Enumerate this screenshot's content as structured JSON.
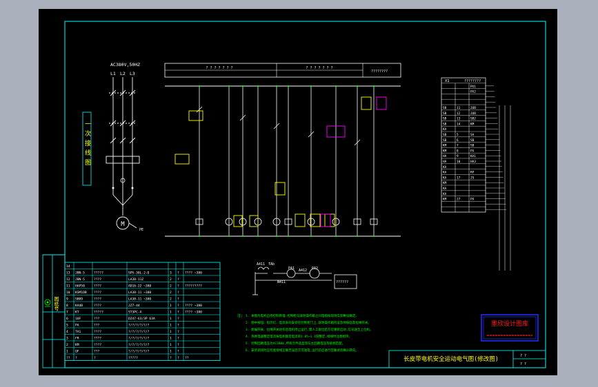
{
  "drawing": {
    "title": "长皮带电机安全运动电气图(修改图)",
    "stamp_text": "墨欣设计图库",
    "supply_label": "AC380V,50HZ",
    "phase_labels": [
      "L1",
      "L2",
      "L3"
    ],
    "motor_label": "M",
    "ground_label": "PE",
    "primary_circuit_label": "一次接线图",
    "left_stamp": "图纸号",
    "colors": {
      "background": "#000000",
      "frame": "#00ffff",
      "line": "#ffffff",
      "yellow": "#ffff00",
      "green": "#00ff00",
      "magenta": "#ff00ff",
      "red": "#ff2020",
      "blue": "#2030ff"
    }
  },
  "header_strip": {
    "left_title": "? ? ? ? ? ? ?",
    "mid_title": "? ? ? ? ? ? ?",
    "right_title": "????????"
  },
  "terminal_block": {
    "title": "X1",
    "title_right": "????????",
    "rows": [
      [
        "",
        "",
        "PX1"
      ],
      [
        "",
        "",
        "PX2"
      ],
      [
        "",
        "",
        ""
      ],
      [
        "",
        "",
        ""
      ],
      [
        "SB",
        "11",
        "JOB"
      ],
      [
        "SB",
        "12",
        "JOB"
      ],
      [
        "SB",
        "13",
        "SB2"
      ],
      [
        "SB",
        "14",
        "KM"
      ],
      [
        "KA",
        "",
        ""
      ],
      [
        "SB",
        "5",
        "SA"
      ],
      [
        "SB",
        "6",
        "SB"
      ],
      [
        "KM",
        "7",
        "SB"
      ],
      [
        "KM",
        "8",
        "PX"
      ],
      [
        "HA",
        "9",
        "KA1"
      ],
      [
        "HA",
        "10",
        "HA3"
      ],
      [
        "KA",
        "",
        ""
      ],
      [
        "KA",
        "",
        "RP"
      ],
      [
        "KA",
        "17",
        "JS"
      ],
      [
        "KM",
        "",
        ""
      ],
      [
        "KA",
        "",
        ""
      ],
      [
        "KA",
        "",
        ""
      ],
      [
        "KM",
        "27",
        "PX"
      ],
      [
        "",
        "",
        ""
      ],
      [
        "",
        "",
        ""
      ]
    ]
  },
  "parts_list": {
    "rows": [
      [
        "14",
        "",
        "",
        "",
        "",
        "",
        ""
      ],
      [
        "13",
        "JBN-5",
        "?????",
        "SPS-30L-2-D",
        "3",
        "?",
        "???? ~380"
      ],
      [
        "12",
        "JBN-5",
        "????",
        "LA38-11Z",
        "2",
        "?",
        ""
      ],
      [
        "11",
        "HAP50",
        "????",
        "AD16-22 ~380",
        "2",
        "?",
        "?????????"
      ],
      [
        "10",
        "KSM1DB",
        "????",
        "LA38-11 ~380",
        "2",
        "?",
        ""
      ],
      [
        "9",
        "SB09",
        "????",
        "LA38-11 ~380",
        "2",
        "?",
        ""
      ],
      [
        "8",
        "KA4B",
        "????",
        "JZ7-44",
        "1",
        "?",
        "???? ~380"
      ],
      [
        "7",
        "KT",
        "?????",
        "ST3PC-A",
        "1",
        "?",
        "???? ~380"
      ],
      [
        "6",
        "10F",
        "???",
        "DZ47-63/3P 63A",
        "1",
        "?",
        ""
      ],
      [
        "5",
        "PA",
        "???",
        "?/?/?/?/?/?",
        "1",
        "?",
        ""
      ],
      [
        "4",
        "TA1",
        "????",
        "?/?/?/?/?/?",
        "1",
        "?",
        ""
      ],
      [
        "3",
        "FR",
        "????",
        "?/?/?/?/?/?",
        "1",
        "?",
        ""
      ],
      [
        "2",
        "KM",
        "????",
        "?/?/?/?/?/?",
        "1",
        "?",
        ""
      ],
      [
        "1",
        "QF",
        "???",
        "?/?/?/?/?/?",
        "1",
        "?",
        ""
      ],
      [
        "??",
        "?",
        "?",
        "?????",
        "?",
        "?",
        "??"
      ]
    ]
  },
  "ammeter": {
    "ta_label": "TAb",
    "labels": [
      "A411",
      "PA1",
      "A412",
      "PA2",
      "N411"
    ],
    "box_label": "??????"
  },
  "notes": {
    "heading": "注:",
    "lines": [
      "1. 本图为电机启停控制原理,控制柜与就地操作箱之间电缆按现场实际敷设确定。",
      "2. 图中按钮、指示灯、电流表均安装在控制柜门上,就地操作箱内设急停按钮及拉绳开关。",
      "3. 跑偏开关、拉绳开关动作后电机停止运行,需人工复位后方可重新启动,信号送至上位机。",
      "4. 热继电器整定电流按电机额定电流的1.05~1.1倍整定,接线时注意相序。",
      "5. 控制回路电压为AC380V,所有元件选型须与主回路电压等级相匹配。",
      "6. 安装调试时应检查接线正确无误后方可送电,运行前应进行空载试验确认转向。"
    ]
  },
  "title_block": {
    "scale_cells": [
      "? ?",
      "? ?"
    ]
  }
}
